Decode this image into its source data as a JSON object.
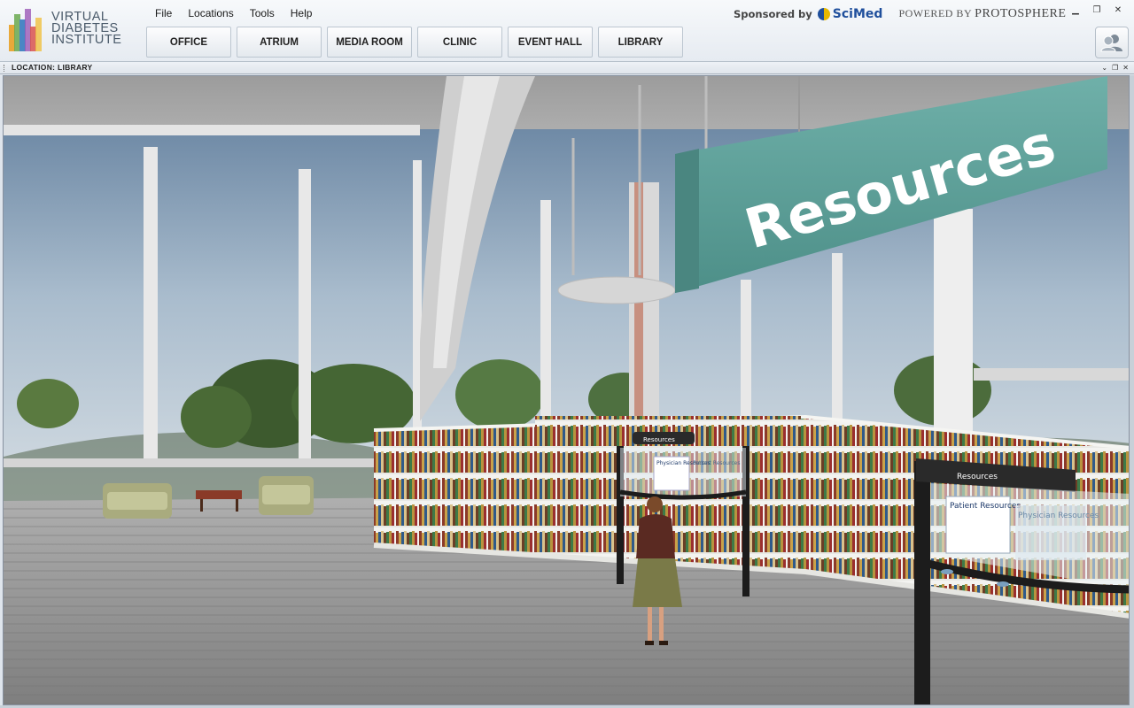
{
  "app": {
    "logo_line1": "VIRTUAL",
    "logo_line2": "DIABETES",
    "logo_line3": "INSTITUTE"
  },
  "menu": [
    "File",
    "Locations",
    "Tools",
    "Help"
  ],
  "sponsor": {
    "label": "Sponsored by",
    "brand": "SciMed",
    "powered_by": "POWERED BY",
    "platform": "PROTOSPHERE"
  },
  "nav": [
    "OFFICE",
    "ATRIUM",
    "MEDIA ROOM",
    "CLINIC",
    "EVENT HALL",
    "LIBRARY"
  ],
  "location": {
    "label": "LOCATION: LIBRARY"
  },
  "scene": {
    "sign": "Resources",
    "kiosk_left_title": "Resources",
    "kiosk_left_item1": "Physician Resources",
    "kiosk_left_item2": "Patient Resources",
    "kiosk_right_title": "Resources",
    "kiosk_right_item1": "Patient Resources",
    "kiosk_right_item2": "Physician Resources"
  },
  "colors": {
    "sign": "#5e9e98",
    "floor": "#8a8a8a",
    "header_bg": "#eef2f6"
  },
  "icons": {
    "people": "people-icon",
    "minimize": "minimize-icon",
    "restore": "restore-icon",
    "close": "close-icon"
  }
}
